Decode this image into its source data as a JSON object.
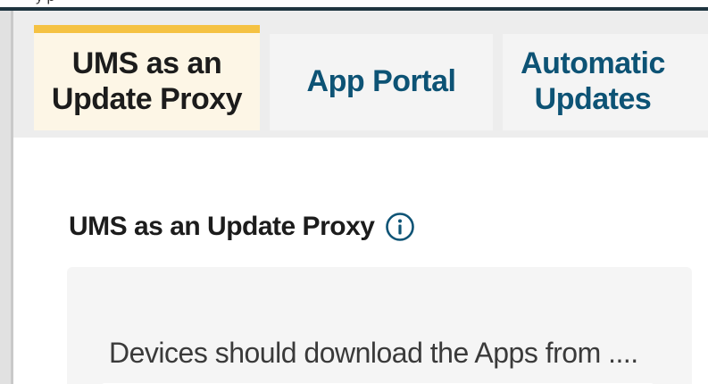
{
  "header": {
    "partial_text": "y p"
  },
  "tabs": [
    {
      "label": "UMS as an\nUpdate Proxy",
      "active": true
    },
    {
      "label": "App Portal",
      "active": false
    },
    {
      "label": "Automatic\nUpdates",
      "active": false
    }
  ],
  "section": {
    "title": "UMS as an Update Proxy",
    "info_icon": "info-circle-icon"
  },
  "panel": {
    "text": "Devices should download the Apps from ...."
  },
  "colors": {
    "active_tab_bg": "#fdf6e6",
    "active_tab_accent": "#f5c243",
    "inactive_tab_text": "#0d5375",
    "header_line": "#1f3540",
    "info_icon": "#0d5375"
  }
}
